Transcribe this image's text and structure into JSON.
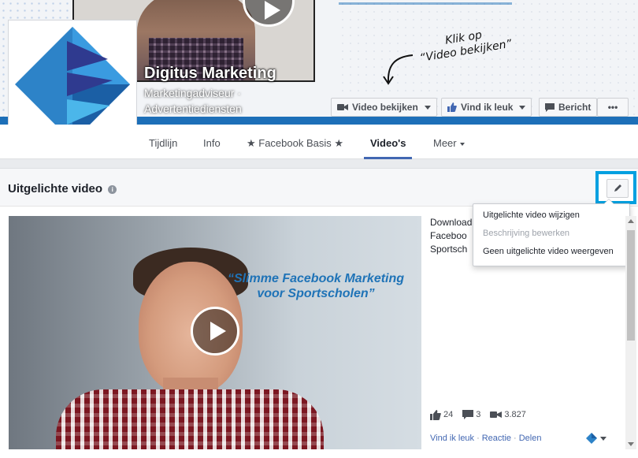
{
  "cover": {
    "annotation_line1": "Klik op",
    "annotation_line2": "“Video bekijken”",
    "page_name": "Digitus Marketing",
    "category_line1": "Marketingadviseur ·",
    "category_line2": "Advertentiediensten"
  },
  "cover_buttons": {
    "watch_video": "Video bekijken",
    "like": "Vind ik leuk",
    "message": "Bericht",
    "more": "•••"
  },
  "tabs": [
    {
      "label": "Tijdlijn"
    },
    {
      "label": "Info"
    },
    {
      "label": "★ Facebook Basis ★"
    },
    {
      "label": "Video's"
    },
    {
      "label": "Meer"
    }
  ],
  "section": {
    "title": "Uitgelichte video",
    "info_icon": "i"
  },
  "edit_menu": {
    "items": [
      {
        "label": "Uitgelichte video wijzigen",
        "enabled": true
      },
      {
        "label": "Beschrijving bewerken",
        "enabled": false
      },
      {
        "label": "Geen uitgelichte video weergeven",
        "enabled": true
      }
    ]
  },
  "video": {
    "overlay_line1": "“Slimme Facebook Marketing",
    "overlay_line2": "voor Sportscholen”",
    "description_lines": [
      "Download",
      "Faceboo",
      "Sportsch"
    ],
    "likes": "24",
    "comments": "3",
    "views": "3.827",
    "action_like": "Vind ik leuk",
    "action_comment": "Reactie",
    "action_share": "Delen",
    "separator": "·"
  },
  "colors": {
    "brand_blue": "#1d6fb8",
    "fb_link": "#4267b2",
    "highlight": "#00a0e0"
  }
}
